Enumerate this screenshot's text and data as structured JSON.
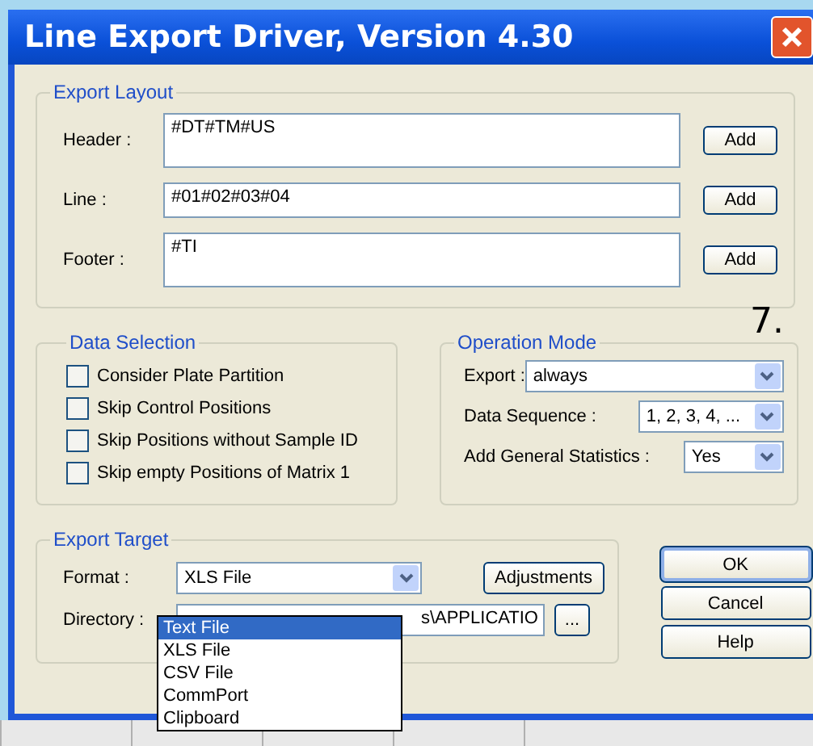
{
  "window": {
    "title": "Line Export Driver, Version 4.30"
  },
  "export_layout": {
    "title": "Export Layout",
    "fields": [
      {
        "kind": "tall",
        "label": "Header :",
        "value": "#DT#TM#US",
        "button": "Add"
      },
      {
        "kind": "short",
        "label": "Line :",
        "value": "#01#02#03#04",
        "button": "Add"
      },
      {
        "kind": "tall",
        "label": "Footer :",
        "value": "#TI",
        "button": "Add"
      }
    ]
  },
  "annotation": "7.",
  "data_selection": {
    "title": "Data Selection",
    "options": [
      {
        "label": "Consider Plate Partition",
        "checked": false
      },
      {
        "label": "Skip Control Positions",
        "checked": false
      },
      {
        "label": "Skip Positions without Sample ID",
        "checked": false
      },
      {
        "label": "Skip empty Positions of Matrix 1",
        "checked": false
      }
    ]
  },
  "operation_mode": {
    "title": "Operation Mode",
    "settings": [
      {
        "label": "Export :",
        "value": "always"
      },
      {
        "label": "Data Sequence :",
        "value": "1, 2, 3, 4, ..."
      },
      {
        "label": "Add General Statistics :",
        "value": "Yes"
      }
    ]
  },
  "export_target": {
    "title": "Export Target",
    "format_label": "Format :",
    "format_value": "XLS File",
    "adjustments_button": "Adjustments",
    "directory_label": "Directory :",
    "directory_value": "s\\APPLICATIO",
    "browse_button": "...",
    "format_options": [
      {
        "label": "Text File",
        "selected": true
      },
      {
        "label": "XLS File",
        "selected": false
      },
      {
        "label": "CSV File",
        "selected": false
      },
      {
        "label": "CommPort",
        "selected": false
      },
      {
        "label": "Clipboard",
        "selected": false
      }
    ]
  },
  "buttons": [
    "OK",
    "Cancel",
    "Help"
  ]
}
